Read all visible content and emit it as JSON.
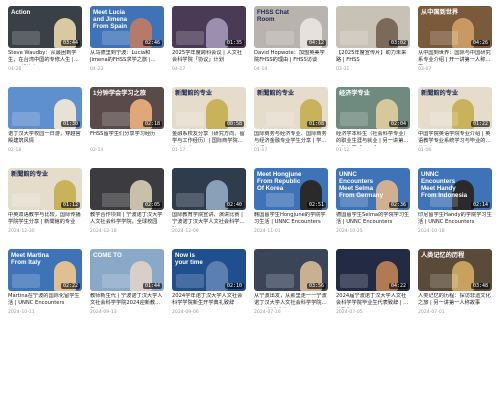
{
  "videos": [
    {
      "title": "Steve Waudby：从最困到学生，在台湾中国的专修人生 | FHSS投资家",
      "date": "04-28",
      "duration": "03:44",
      "caption": "Action",
      "bg": "#3a4048",
      "accent": "#d8c9a0",
      "caption_style": "light"
    },
    {
      "title": "从马德里到宁波：Lucia和Jimena的FHSS求学之旅 | UNNC Encounters",
      "date": "04-23",
      "duration": "02:46",
      "caption": "Meet Lucia\nand Jimena\nFrom Spain",
      "bg": "#3f73b8",
      "accent": "#b57a6a",
      "caption_style": "light"
    },
    {
      "title": "2025学年度跨科会议 | 人文社会科学院「协议」计划",
      "date": "04-17",
      "duration": "01:35",
      "caption": "",
      "bg": "#4a3a56",
      "accent": "#9b8fb0",
      "caption_style": "light"
    },
    {
      "title": "David Hopwote：加盟英美学院FHSS的理由 | FHSS访谈",
      "date": "04-14",
      "duration": "04:12",
      "caption": "FHSS Chat\nRoom",
      "bg": "#b9b3ad",
      "accent": "#e6e1dc",
      "caption_style": "dark"
    },
    {
      "title": "【2025年度宣传片】助力未来路 | FHSS",
      "date": "03-31",
      "duration": "03:02",
      "caption": "",
      "bg": "#c8c2b6",
      "accent": "#7b6a5a",
      "caption_style": "light"
    },
    {
      "title": "从中国到世界：国际与中国研究系专业介绍 | 开一讲第一人称故事",
      "date": "03-07",
      "duration": "04:26",
      "caption": "从中国到世界",
      "bg": "#7a5a3a",
      "accent": "#c69a62",
      "caption_style": "light"
    },
    {
      "title": "诺丁汉大学校园一日游，穿越宫殿建筑风情",
      "date": "02-18",
      "duration": "01:30",
      "caption": "",
      "bg": "#5e8fcf",
      "accent": "#e8e2d4",
      "caption_style": "light"
    },
    {
      "title": "FHSS留学生们分享学习经历",
      "date": "02-14",
      "duration": "02:18",
      "caption": "1分钟学会学习之旅",
      "bg": "#5a4a4a",
      "accent": "#e0a878",
      "caption_style": "light"
    },
    {
      "title": "金融系校友分享（研究方向、留学与工作经历）| 国际商学院学生分享会",
      "date": "01-17",
      "duration": "00:58",
      "caption": "新聞館的专业",
      "bg": "#e6dccb",
      "accent": "#c9b35a",
      "caption_style": "dark"
    },
    {
      "title": "国际商务与经济专业、国际商务与经济金融专业学生分享 | 学院介绍",
      "date": "01-17",
      "duration": "01:08",
      "caption": "新聞館的专业",
      "bg": "#e6dccb",
      "accent": "#c9b35a",
      "caption_style": "dark"
    },
    {
      "title": "经济学本科生（社会科学专业）的职业生涯与就业 | 另一讲第一人称故事【Slow】",
      "date": "01-12",
      "duration": "02:04",
      "caption": "经济学专业",
      "bg": "#6f8a7f",
      "accent": "#d6c89a",
      "caption_style": "light"
    },
    {
      "title": "中国学院英语学院专业介绍 | 英语教学专业系统学习与毕业的专业分享",
      "date": "01-06",
      "duration": "01:22",
      "caption": "新聞館的专业",
      "bg": "#e6dccb",
      "accent": "#c9b35a",
      "caption_style": "dark"
    },
    {
      "title": "中英双语教学与比较，国际传播学院学生分享 | 新聞館的专业",
      "date": "2024-12-30",
      "duration": "01:12",
      "caption": "新聞館的专业",
      "bg": "#e6dccb",
      "accent": "#c9b35a",
      "caption_style": "dark"
    },
    {
      "title": "教学合作项目 | 宁波诺丁汉大学人文社会科学学院，全球校园",
      "date": "2024-12-18",
      "duration": "02:05",
      "caption": "",
      "bg": "#3c3c40",
      "accent": "#c8c0a8",
      "caption_style": "light"
    },
    {
      "title": "国际教育学院宣讲、演讲比赛 | 宁波诺丁汉大学人文社会科学学院",
      "date": "2024-12-09",
      "duration": "02:40",
      "caption": "",
      "bg": "#2e3c4c",
      "accent": "#8aa0b8",
      "caption_style": "light"
    },
    {
      "title": "韩国留学生Hongjune的学院学习生活 | UNNC Encounters",
      "date": "2024-11-01",
      "duration": "02:51",
      "caption": "Meet Hongjune\nFrom Republic\nOf Korea",
      "bg": "#3f73b8",
      "accent": "#2a2a2a",
      "caption_style": "light"
    },
    {
      "title": "德国留学生Selma的学院学习生活 | UNNC Encounters",
      "date": "2024-10-25",
      "duration": "02:36",
      "caption": "UNNC\nEncounters\nMeet Selma\nFrom Germany",
      "bg": "#3f73b8",
      "accent": "#d0b090",
      "caption_style": "light"
    },
    {
      "title": "印尼留学生Handy的学院学习生活 | UNNC Encounters",
      "date": "2024-10-18",
      "duration": "02:14",
      "caption": "UNNC\nEncounters\nMeet Handy\nFrom Indonesia",
      "bg": "#3f73b8",
      "accent": "#2a2a2a",
      "caption_style": "light"
    },
    {
      "title": "Martina在宁波的国际化留学生活 | UNNC Encounters",
      "date": "2024-10-11",
      "duration": "02:22",
      "caption": "Meet Martina\nFrom Italy",
      "bg": "#3f73b8",
      "accent": "#e0c090",
      "caption_style": "light"
    },
    {
      "title": "教师新生代 | 宁波诺丁汉大学人文社会科学学院2024迎新教师见面会",
      "date": "2024-09-13",
      "duration": "01:44",
      "caption": "COME TO",
      "bg": "#8aa8c8",
      "accent": "#d8d0c8",
      "caption_style": "light"
    },
    {
      "title": "2024学年诺丁汉大学人文社会科学学院新生开学典礼致辞",
      "date": "2024-09-06",
      "duration": "02:10",
      "caption": "Now is\nyour time",
      "bg": "#1f4f8f",
      "accent": "#5b7fb0",
      "caption_style": "light"
    },
    {
      "title": "从宁波出发，从那里走一一宁波诺丁汉大学人文社会科学学院2024毕业典礼",
      "date": "2024-07-16",
      "duration": "03:56",
      "caption": "",
      "bg": "#3a4658",
      "accent": "#c8b090",
      "caption_style": "light"
    },
    {
      "title": "2024届宁波诺丁汉大学人文社会科学学院毕业生代表致辞 | 毕业致辞",
      "date": "2024-07-05",
      "duration": "04:22",
      "caption": "",
      "bg": "#222a44",
      "accent": "#b07a52",
      "caption_style": "light"
    },
    {
      "title": "人类记忆的历程：探访非遗文化之旅 | 另一讲第一人称故事",
      "date": "2024-07-01",
      "duration": "03:48",
      "caption": "人类记忆的历程",
      "bg": "#5a4a3a",
      "accent": "#c8a060",
      "caption_style": "light"
    }
  ]
}
